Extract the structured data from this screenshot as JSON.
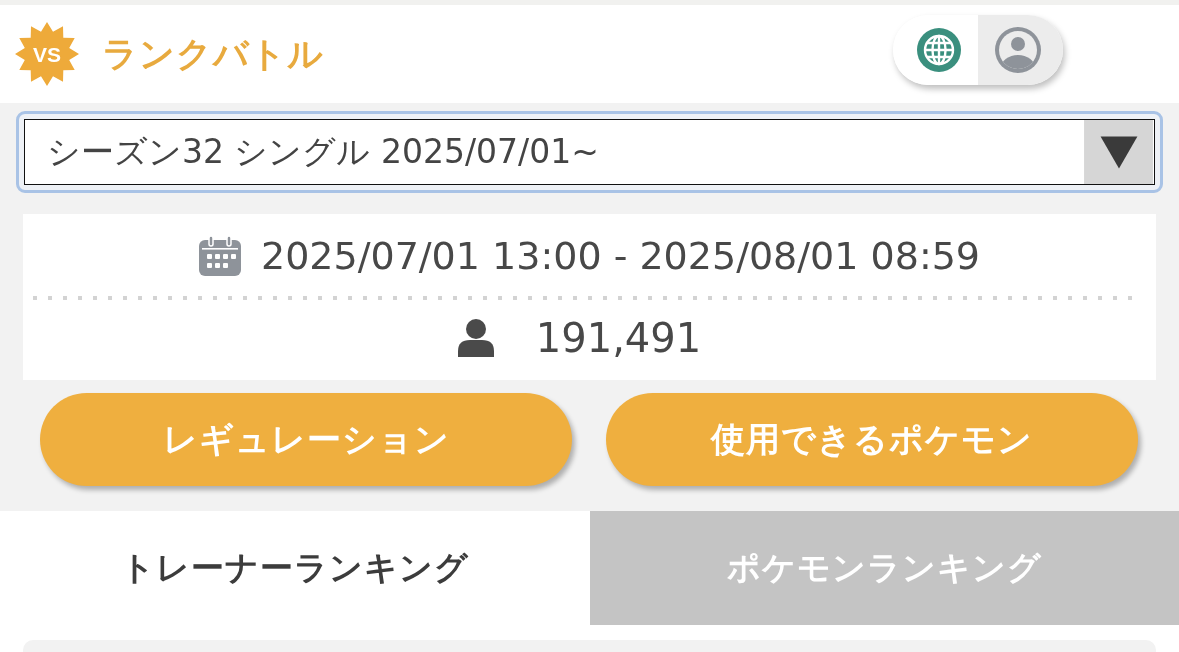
{
  "header": {
    "logo_text": "VS",
    "title": "ランクバトル",
    "toggle": [
      {
        "kind": "language",
        "selected": false
      },
      {
        "kind": "account",
        "selected": true
      }
    ]
  },
  "season_select": {
    "value": "シーズン32 シングル 2025/07/01~"
  },
  "season_info": {
    "period": "2025/07/01 13:00 - 2025/08/01 08:59",
    "players": "191,491"
  },
  "buttons": [
    "レギュレーション",
    "使用できるポケモン"
  ],
  "tabs": [
    {
      "label": "トレーナーランキング",
      "selected": true
    },
    {
      "label": "ポケモンランキング",
      "selected": false
    }
  ]
}
